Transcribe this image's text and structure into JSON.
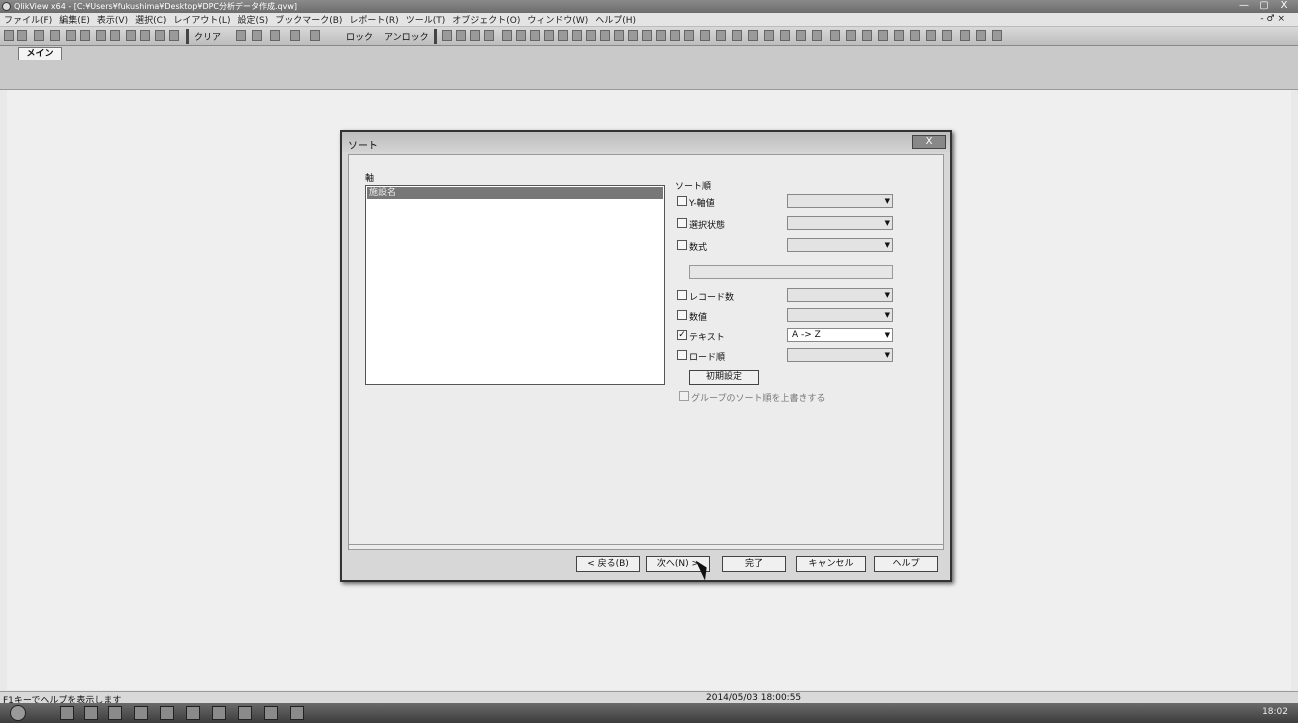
{
  "window": {
    "title": "QlikView x64 - [C:¥Users¥fukushima¥Desktop¥DPC分析データ作成.qvw]",
    "buttons": [
      "—",
      "▢",
      "X"
    ]
  },
  "menu": {
    "items": [
      "ファイル(F)",
      "編集(E)",
      "表示(V)",
      "選択(C)",
      "レイアウト(L)",
      "設定(S)",
      "ブックマーク(B)",
      "レポート(R)",
      "ツール(T)",
      "オブジェクト(O)",
      "ウィンドウ(W)",
      "ヘルプ(H)"
    ],
    "mdi_controls": "- ♂ ×"
  },
  "toolbar": {
    "clear_label": "クリア",
    "lock_label": "ロック",
    "unlock_label": "アンロック"
  },
  "tabs": [
    {
      "label": "メイン"
    }
  ],
  "dialog": {
    "title": "ソート",
    "close": "X",
    "dimension_label": "軸",
    "dimension_selected": "施設名",
    "sort_order_label": "ソート順",
    "rows": [
      {
        "label": "Y-軸値",
        "checked": false,
        "value": ""
      },
      {
        "label": "選択状態",
        "checked": false,
        "value": ""
      },
      {
        "label": "数式",
        "checked": false,
        "value": ""
      },
      {
        "label": "レコード数",
        "checked": false,
        "value": ""
      },
      {
        "label": "数値",
        "checked": false,
        "value": ""
      },
      {
        "label": "テキスト",
        "checked": true,
        "value": "A -> Z"
      },
      {
        "label": "ロード順",
        "checked": false,
        "value": ""
      }
    ],
    "reset_button": "初期設定",
    "group_override": "グループのソート順を上書きする",
    "footer": {
      "back": "< 戻る(B)",
      "next": "次へ(N) >",
      "finish": "完了",
      "cancel": "キャンセル",
      "help": "ヘルプ"
    }
  },
  "status": {
    "help_text": "F1キーでヘルプを表示します",
    "datetime": "2014/05/03 18:00:55"
  },
  "taskbar": {
    "clock": "18:02"
  }
}
